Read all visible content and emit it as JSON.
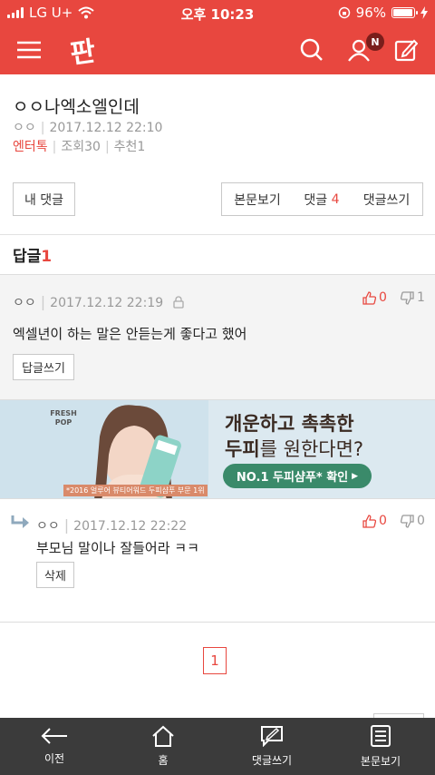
{
  "status_bar": {
    "carrier": "LG U+",
    "time": "오후 10:23",
    "battery": "96%"
  },
  "nav": {
    "logo": "판",
    "badge": "N"
  },
  "post": {
    "title": "ㅇㅇ나엑소엘인데",
    "author": "ㅇㅇ",
    "date": "2017.12.12 22:10",
    "category": "엔터톡",
    "views": "조회30",
    "recommend": "추천1"
  },
  "actions": {
    "my_comments": "내 댓글",
    "view_post": "본문보기",
    "comments_label": "댓글",
    "comments_count": "4",
    "write_comment": "댓글쓰기"
  },
  "replies": {
    "label": "답글",
    "count": "1"
  },
  "comment": {
    "author": "ㅇㅇ",
    "date": "2017.12.12 22:19",
    "text": "엑셀년이 하는 말은 안듣는게 좋다고 했어",
    "likes": "0",
    "dislikes": "1",
    "reply_button": "답글쓰기"
  },
  "ad": {
    "brand": "FRESH POP",
    "headline1_prefix": "개운하고 ",
    "headline1_bold": "촉촉한",
    "headline2_bold": "두피",
    "headline2_rest": "를 원한다면?",
    "cta": "NO.1 두피샴푸* 확인",
    "footnote": "*2016 얼루어 뷰티어워드 두피샴푸 부문 1위"
  },
  "reply": {
    "author": "ㅇㅇ",
    "date": "2017.12.12 22:22",
    "text": "부모님 말이나 잘들어라 ㅋㅋ",
    "likes": "0",
    "dislikes": "0",
    "delete_button": "삭제"
  },
  "pagination": {
    "current": "1"
  },
  "bottom_tabs": [
    {
      "label": "이전",
      "icon": "back-arrow-icon"
    },
    {
      "label": "홈",
      "icon": "home-icon"
    },
    {
      "label": "댓글쓰기",
      "icon": "write-comment-icon"
    },
    {
      "label": "본문보기",
      "icon": "document-icon"
    }
  ],
  "colors": {
    "accent": "#e8473f",
    "bottom_bar": "#3b3b3b",
    "ad_green": "#3a8a6a"
  }
}
